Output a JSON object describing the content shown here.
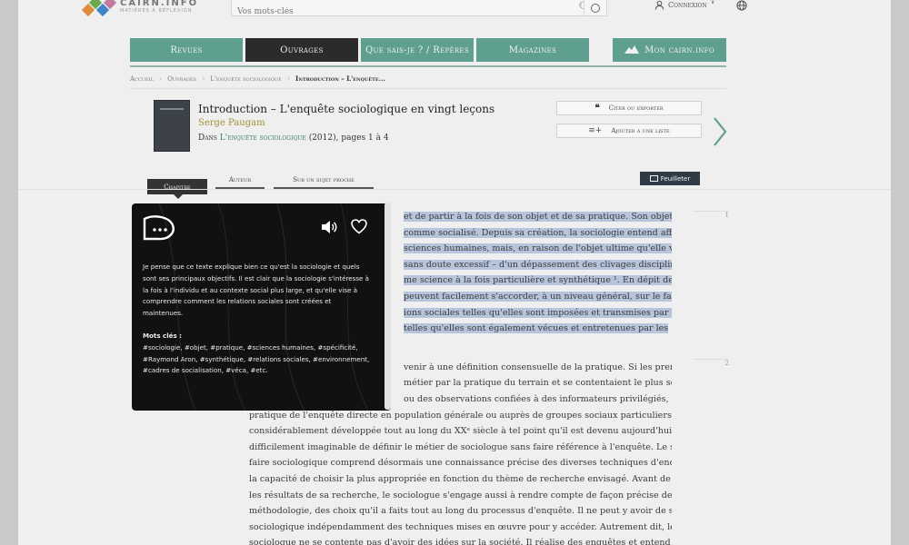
{
  "header": {
    "logo_title": "CAIRN.INFO",
    "logo_subtitle": "MATIÈRES À RÉFLEXION",
    "search_placeholder": "Vos mots-clés",
    "login_label": "Connexion",
    "login_chevron": "∨",
    "lang_icon": "🌐",
    "logo_colors": [
      "#e08a3c",
      "#6aa84f",
      "#3d85c6",
      "#c27ba0"
    ]
  },
  "nav": {
    "tabs": [
      {
        "label": "Revues",
        "color": "#5f9f90"
      },
      {
        "label": "Ouvrages",
        "color": "#2b2b2b"
      },
      {
        "label": "Que sais-je ? / Repères",
        "color": "#5f9f90"
      },
      {
        "label": "Magazines",
        "color": "#5f9f90"
      }
    ],
    "mon_cairn": {
      "label": "Mon cairn.info",
      "color": "#5f9f90"
    }
  },
  "breadcrumb": [
    "Accueil",
    "Ouvrages",
    "L'enquête sociologique",
    "Introduction – L'enquête..."
  ],
  "book": {
    "title": "Introduction – L'enquête sociologique en vingt leçons",
    "author": "Serge Paugam",
    "source_prefix": "Dans",
    "source_link": "L'enquête sociologique",
    "source_suffix": "(2012), pages 1 à 4"
  },
  "actions": {
    "cite": "Citer ou exporter",
    "add_list": "Ajouter à une liste"
  },
  "tabs": {
    "active": "Chapitre",
    "author": "Auteur",
    "related": "Sur un sujet proche",
    "feuilleter": "Feuilleter"
  },
  "text": {
    "para1": [
      {
        "text": "et de partir à la fois de son objet et de sa pratique. Son objet",
        "hl": true
      },
      {
        "text": "comme socialisé. Depuis sa création, la sociologie entend affirmer",
        "hl": true
      },
      {
        "text": "sciences humaines, mais, en raison de l'objet ultime qu'elle vise, elle",
        "hl": true
      },
      {
        "text": "sans doute excessif – d'un dépassement des clivages disciplinaires,",
        "hl": true
      },
      {
        "text": "me science à la fois particulière et synthétique ¹. En dépit de ce",
        "hl": true
      },
      {
        "text": "peuvent facilement s'accorder, à un niveau général, sur le fait que",
        "hl": true
      },
      {
        "text": "ions sociales telles qu'elles sont imposées et transmises par le",
        "hl": true
      },
      {
        "text": "telles qu'elles sont également vécues et entretenues par les",
        "hl": true
      }
    ],
    "para2": [
      {
        "text": "venir à une définition consensuelle de la pratique. Si les premiers",
        "indent": 190
      },
      {
        "text": "métier par la pratique du terrain et se contentaient le plus souvent",
        "indent": 190
      },
      {
        "text": "ou des observations confiées à des informateurs privilégiés, la",
        "indent": 190
      },
      {
        "text": "pratique de l'enquête directe en population générale ou auprès de groupes sociaux particuliers s'est",
        "indent": 20
      },
      {
        "text": "considérablement développée tout au long du XXᵉ siècle à tel point qu'il est devenu aujourd'hui",
        "indent": 20
      },
      {
        "text": "difficilement imaginable de définir le métier de sociologue sans faire référence à l'enquête. Le savoir-",
        "indent": 20
      },
      {
        "text": "faire sociologique comprend désormais une connaissance précise des diverses techniques d'enquête et",
        "indent": 20
      },
      {
        "text": "la capacité de choisir la plus appropriée en fonction du thème de recherche envisagé. Avant de restituer",
        "indent": 20
      },
      {
        "text": "les résultats de sa recherche, le sociologue s'engage aussi à rendre compte de façon précise de sa",
        "indent": 20
      },
      {
        "text": "méthodologie, des choix qu'il a faits tout au long du processus d'enquête. Il ne peut y avoir de savoir",
        "indent": 20
      },
      {
        "text": "sociologique indépendamment des techniques mises en œuvre pour y accéder. Autrement dit, le",
        "indent": 20
      },
      {
        "text": "sociologue ne se contente pas d'avoir des idées sur la société. Il réalise des enquêtes et entend mettre les",
        "indent": 20
      }
    ],
    "para_numbers": [
      "1",
      "2"
    ]
  },
  "popup": {
    "summary": "Je pense que ce texte explique bien ce qu'est la sociologie et quels sont ses principaux objectifs. Il est clair que la sociologie s'intéresse à la fois à l'individu et au contexte social plus large, et qu'elle vise à comprendre comment les relations sociales sont créées et maintenues.",
    "keywords_title": "Mots clés :",
    "keywords": "#sociologie, #objet, #pratique, #sciences humaines, #spécificité, #Raymond Aron, #synthétique, #relations sociales, #environnement, #cadres de socialisation, #véca, #etc."
  }
}
